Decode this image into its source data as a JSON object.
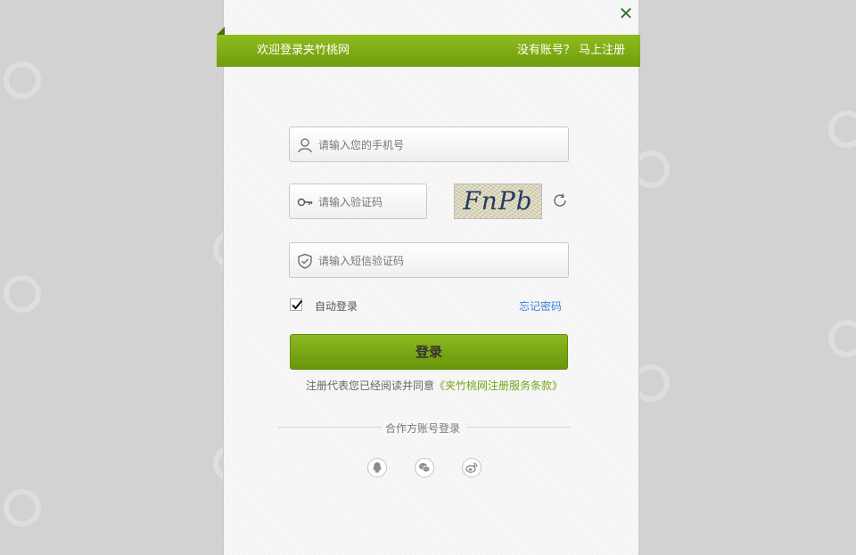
{
  "header": {
    "title": "欢迎登录夹竹桃网",
    "register_link": "没有账号？ 马上注册"
  },
  "form": {
    "phone_placeholder": "请输入您的手机号",
    "captcha_placeholder": "请输入验证码",
    "captcha_text": "FnPb",
    "sms_placeholder": "请输入短信验证码",
    "auto_login_label": "自动登录",
    "auto_login_checked": true,
    "forgot_password": "忘记密码",
    "login_button": "登录",
    "agreement_prefix": "注册代表您已经阅读并同意",
    "agreement_link": "《夹竹桃网注册服务条款》"
  },
  "partner": {
    "label": "合作方账号登录",
    "providers": [
      "qq-icon",
      "wechat-icon",
      "weibo-icon"
    ]
  },
  "colors": {
    "brand_green": "#7aa31a",
    "link_blue": "#3f7fd8",
    "close_green": "#2a7a2a"
  }
}
